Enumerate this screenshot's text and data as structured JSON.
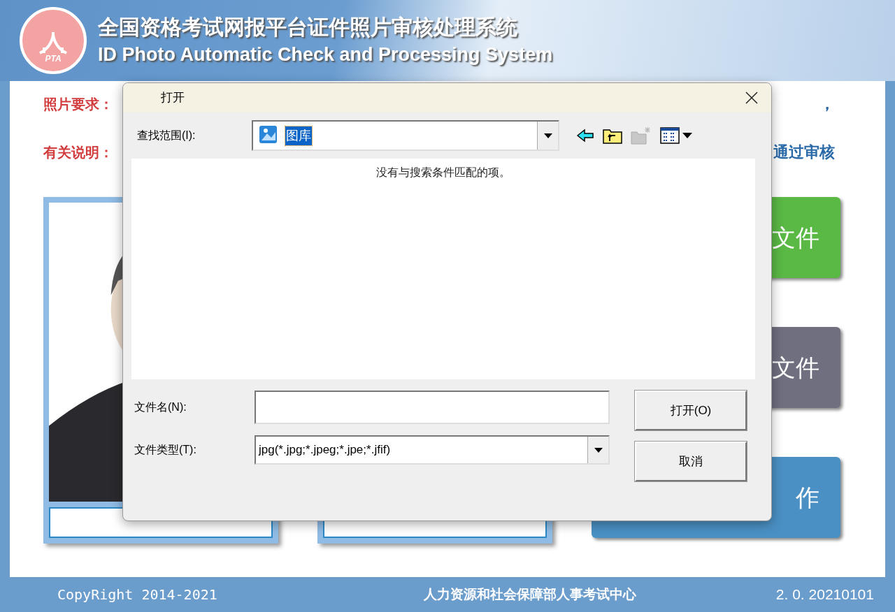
{
  "header": {
    "title_cn": "全国资格考试网报平台证件照片审核处理系统",
    "title_en": "ID Photo Automatic Check and Processing System",
    "logo_text": "PTA"
  },
  "notes": [
    {
      "label": "照片要求：",
      "tail": "，"
    },
    {
      "label": "有关说明：",
      "tail": "通过审核"
    }
  ],
  "panels": [
    {
      "kind": "picture"
    },
    {
      "kind": "text"
    }
  ],
  "actions": [
    {
      "label": "文件",
      "color": "#5ab845"
    },
    {
      "label": "文件",
      "color": "#6f6f80"
    },
    {
      "label": "作",
      "color": "#4a90c4"
    }
  ],
  "footer": {
    "copyright": "CopyRight  2014-2021",
    "org": "人力资源和社会保障部人事考试中心",
    "version": "2. 0. 20210101"
  },
  "dialog": {
    "title": "打开",
    "look_in_label": "查找范围(I):",
    "look_in_value": "图库",
    "empty_message": "没有与搜索条件匹配的项。",
    "filename_label": "文件名(N):",
    "filetype_label": "文件类型(T):",
    "filetype_value": "jpg(*.jpg;*.jpeg;*.jpe;*.jfif)",
    "buttons": [
      "打开(O)",
      "取消"
    ]
  }
}
